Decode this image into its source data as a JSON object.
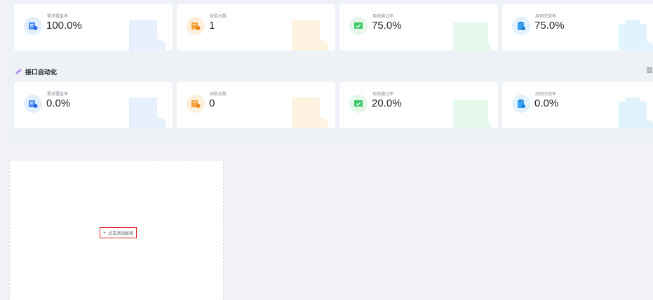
{
  "top_metrics": [
    {
      "label": "需求覆盖率",
      "value": "100.0%",
      "icon": "requirement-coverage-icon",
      "color": "#3b82f6"
    },
    {
      "label": "缺陷总数",
      "value": "1",
      "icon": "defect-icon",
      "color": "#f59e0b"
    },
    {
      "label": "用例通过率",
      "value": "75.0%",
      "icon": "case-pass-icon",
      "color": "#22c55e"
    },
    {
      "label": "用例完成率",
      "value": "75.0%",
      "icon": "case-complete-icon",
      "color": "#0ea5e9"
    }
  ],
  "api_section": {
    "title": "接口自动化",
    "metrics": [
      {
        "label": "需求覆盖率",
        "value": "0.0%",
        "icon": "requirement-coverage-icon",
        "color": "#3b82f6"
      },
      {
        "label": "缺陷总数",
        "value": "0",
        "icon": "defect-icon",
        "color": "#f59e0b"
      },
      {
        "label": "用例通过率",
        "value": "20.0%",
        "icon": "case-pass-icon",
        "color": "#22c55e"
      },
      {
        "label": "用例完成率",
        "value": "0.0%",
        "icon": "case-complete-icon",
        "color": "#0ea5e9"
      }
    ]
  },
  "add_chart": {
    "plus": "+",
    "label": "点击添加报表"
  }
}
